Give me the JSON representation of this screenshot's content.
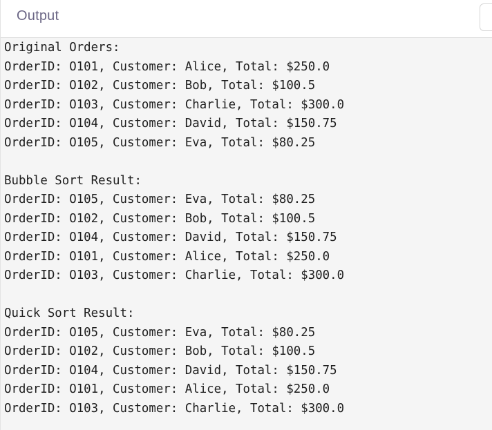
{
  "header": {
    "title": "Output"
  },
  "output": {
    "lines": [
      "Original Orders:",
      "OrderID: O101, Customer: Alice, Total: $250.0",
      "OrderID: O102, Customer: Bob, Total: $100.5",
      "OrderID: O103, Customer: Charlie, Total: $300.0",
      "OrderID: O104, Customer: David, Total: $150.75",
      "OrderID: O105, Customer: Eva, Total: $80.25",
      "",
      "Bubble Sort Result:",
      "OrderID: O105, Customer: Eva, Total: $80.25",
      "OrderID: O102, Customer: Bob, Total: $100.5",
      "OrderID: O104, Customer: David, Total: $150.75",
      "OrderID: O101, Customer: Alice, Total: $250.0",
      "OrderID: O103, Customer: Charlie, Total: $300.0",
      "",
      "Quick Sort Result:",
      "OrderID: O105, Customer: Eva, Total: $80.25",
      "OrderID: O102, Customer: Bob, Total: $100.5",
      "OrderID: O104, Customer: David, Total: $150.75",
      "OrderID: O101, Customer: Alice, Total: $250.0",
      "OrderID: O103, Customer: Charlie, Total: $300.0"
    ]
  }
}
